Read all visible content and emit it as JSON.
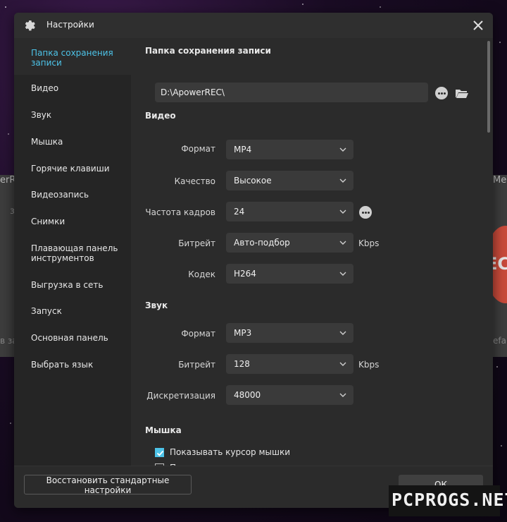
{
  "window": {
    "title": "Настройки"
  },
  "background": {
    "app_title_fragment_left": "erR",
    "app_title_fragment_right": "Me",
    "rec_fragment": "EC",
    "side_text_left": "з",
    "side_text_left2": "в за",
    "side_text_right": "efau"
  },
  "sidebar": {
    "items": [
      {
        "label": "Папка сохранения записи",
        "active": true
      },
      {
        "label": "Видео"
      },
      {
        "label": "Звук"
      },
      {
        "label": "Мышка"
      },
      {
        "label": "Горячие клавиши"
      },
      {
        "label": "Видеозапись"
      },
      {
        "label": "Снимки"
      },
      {
        "label": "Плавающая панель инструментов"
      },
      {
        "label": "Выгрузка в сеть"
      },
      {
        "label": "Запуск"
      },
      {
        "label": "Основная панель"
      },
      {
        "label": "Выбрать язык"
      }
    ]
  },
  "save_folder": {
    "title": "Папка сохранения записи",
    "path": "D:\\ApowerREC\\"
  },
  "video": {
    "title": "Видео",
    "format_label": "Формат",
    "format_value": "MP4",
    "quality_label": "Качество",
    "quality_value": "Высокое",
    "fps_label": "Частота кадров",
    "fps_value": "24",
    "bitrate_label": "Битрейт",
    "bitrate_value": "Авто-подбор",
    "bitrate_unit": "Kbps",
    "codec_label": "Кодек",
    "codec_value": "H264"
  },
  "audio": {
    "title": "Звук",
    "format_label": "Формат",
    "format_value": "MP3",
    "bitrate_label": "Битрейт",
    "bitrate_value": "128",
    "bitrate_unit": "Kbps",
    "sampling_label": "Дискретизация",
    "sampling_value": "48000"
  },
  "mouse": {
    "title": "Мышка",
    "show_cursor_label": "Показывать курсор мышки",
    "show_cursor_checked": true,
    "show_frame_label": "Показывать рамку вокруг курсора мышки",
    "show_frame_checked": false
  },
  "footer": {
    "reset_label": "Восстановить стандартные настройки",
    "ok_label": "ОК"
  },
  "watermark": {
    "text": "PCPROGS.NET"
  },
  "colors": {
    "accent": "#4dc3e8",
    "dialog_bg": "#2b2b2b",
    "sidebar_bg": "#252525",
    "input_bg": "#3a3a3a"
  }
}
